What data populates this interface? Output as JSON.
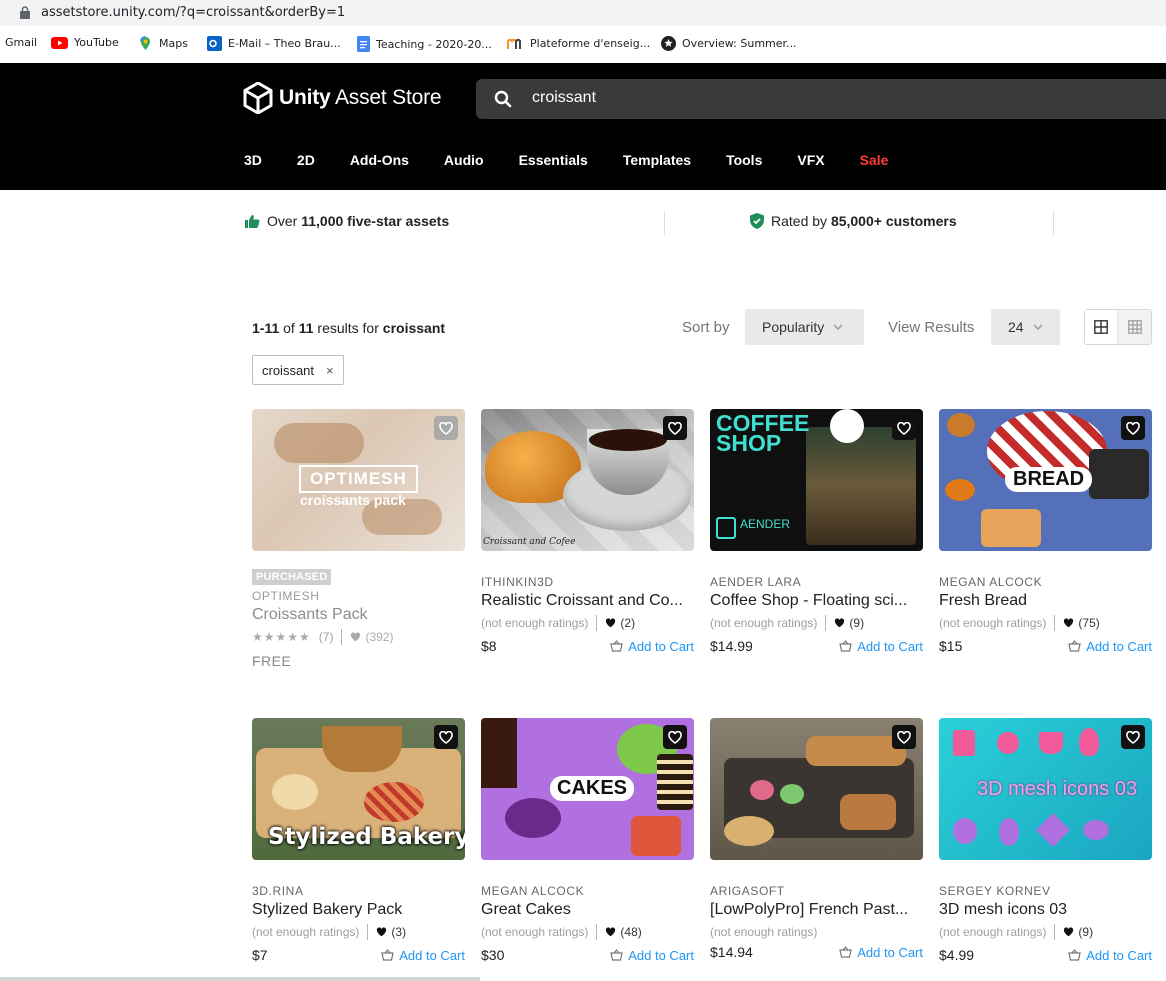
{
  "browser": {
    "url": "assetstore.unity.com/?q=croissant&orderBy=1",
    "bookmarks": [
      "Gmail",
      "YouTube",
      "Maps",
      "E-Mail – Theo Brau...",
      "Teaching - 2020-20...",
      "Plateforme d'enseig...",
      "Overview: Summer..."
    ]
  },
  "header": {
    "brand_bold": "Unity",
    "brand_rest": " Asset Store",
    "search_value": "croissant",
    "nav": [
      "3D",
      "2D",
      "Add-Ons",
      "Audio",
      "Essentials",
      "Templates",
      "Tools",
      "VFX",
      "Sale"
    ]
  },
  "trust": {
    "left_pre": "Over ",
    "left_bold": "11,000 five-star assets",
    "right_pre": "Rated by ",
    "right_bold": "85,000+ customers"
  },
  "results": {
    "range": "1-11",
    "of": " of ",
    "total": "11",
    "for": " results for ",
    "query": "croissant",
    "sort_label": "Sort by",
    "sort_value": "Popularity",
    "view_label": "View Results",
    "view_value": "24",
    "chip": "croissant",
    "chip_close": "×"
  },
  "cards": [
    {
      "publisher": "OPTIMESH",
      "title": "Croissants Pack",
      "rating": "(7)",
      "favs": "(392)",
      "price": "FREE",
      "badge": "PURCHASED",
      "thumb_text": "OPTIMESH",
      "thumb_text2": "croissants pack"
    },
    {
      "publisher": "ITHINKIN3D",
      "title": "Realistic Croissant and Co...",
      "rating": "(not enough ratings)",
      "favs": "(2)",
      "price": "$8",
      "cart": "Add to Cart",
      "thumb_text": "Croissant and Cofee"
    },
    {
      "publisher": "AENDER LARA",
      "title": "Coffee Shop - Floating sci...",
      "rating": "(not enough ratings)",
      "favs": "(9)",
      "price": "$14.99",
      "cart": "Add to Cart",
      "thumb_text": "COFFEE",
      "thumb_text2": "SHOP",
      "thumb_text3": "AENDER"
    },
    {
      "publisher": "MEGAN ALCOCK",
      "title": "Fresh Bread",
      "rating": "(not enough ratings)",
      "favs": "(75)",
      "price": "$15",
      "cart": "Add to Cart",
      "thumb_text": "BREAD"
    },
    {
      "publisher": "3D.RINA",
      "title": "Stylized Bakery Pack",
      "rating": "(not enough ratings)",
      "favs": "(3)",
      "price": "$7",
      "cart": "Add to Cart",
      "thumb_text": "Stylized Bakery"
    },
    {
      "publisher": "MEGAN ALCOCK",
      "title": "Great Cakes",
      "rating": "(not enough ratings)",
      "favs": "(48)",
      "price": "$30",
      "cart": "Add to Cart",
      "thumb_text": "CAKES"
    },
    {
      "publisher": "ARIGASOFT",
      "title": "[LowPolyPro] French Past...",
      "rating": "(not enough ratings)",
      "price": "$14.94",
      "cart": "Add to Cart"
    },
    {
      "publisher": "SERGEY KORNEV",
      "title": "3D mesh icons 03",
      "rating": "(not enough ratings)",
      "favs": "(9)",
      "price": "$4.99",
      "cart": "Add to Cart",
      "thumb_text": "3D mesh icons 03"
    }
  ],
  "colors": {
    "header_bg": "#000000",
    "accent_link": "#2196f3",
    "sale": "#ff3a3a",
    "trust_icon": "#1e8e5a"
  }
}
